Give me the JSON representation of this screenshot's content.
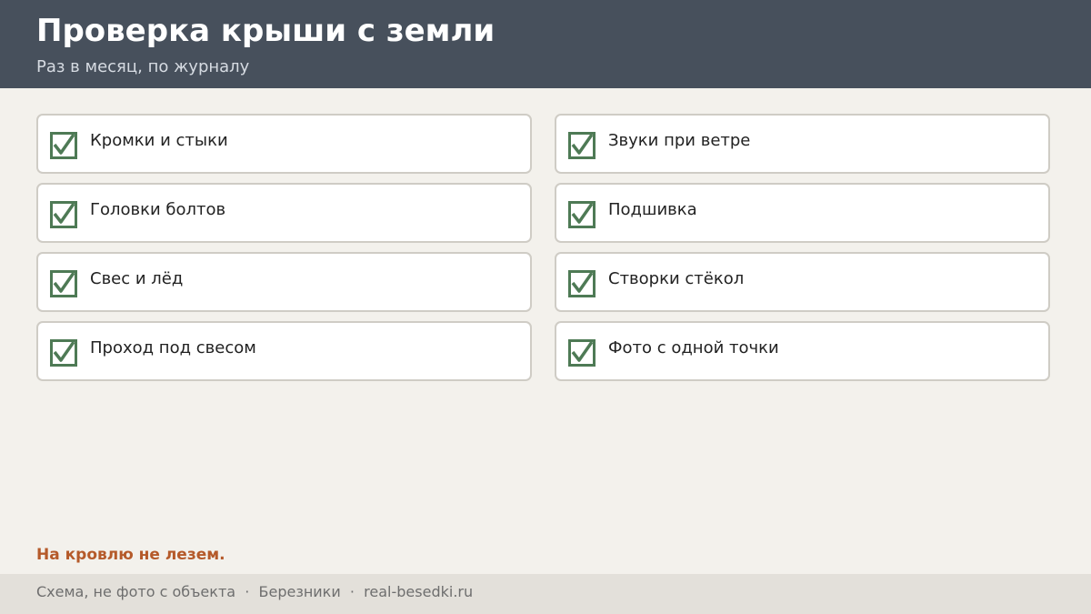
{
  "header": {
    "title": "Проверка крыши с земли",
    "subtitle": "Раз в месяц, по журналу"
  },
  "checklist": {
    "check_color": "#4e7a55",
    "items": [
      {
        "label": "Кромки и стыки",
        "checked": true
      },
      {
        "label": "Звуки при ветре",
        "checked": true
      },
      {
        "label": "Головки болтов",
        "checked": true
      },
      {
        "label": "Подшивка",
        "checked": true
      },
      {
        "label": "Свес и лёд",
        "checked": true
      },
      {
        "label": "Створки стёкол",
        "checked": true
      },
      {
        "label": "Проход под свесом",
        "checked": true
      },
      {
        "label": "Фото с одной точки",
        "checked": true
      }
    ]
  },
  "warning": "На кровлю не лезем.",
  "footer": {
    "text": "Схема, не фото с объекта  ·  Березники  ·  real-besedki.ru"
  }
}
